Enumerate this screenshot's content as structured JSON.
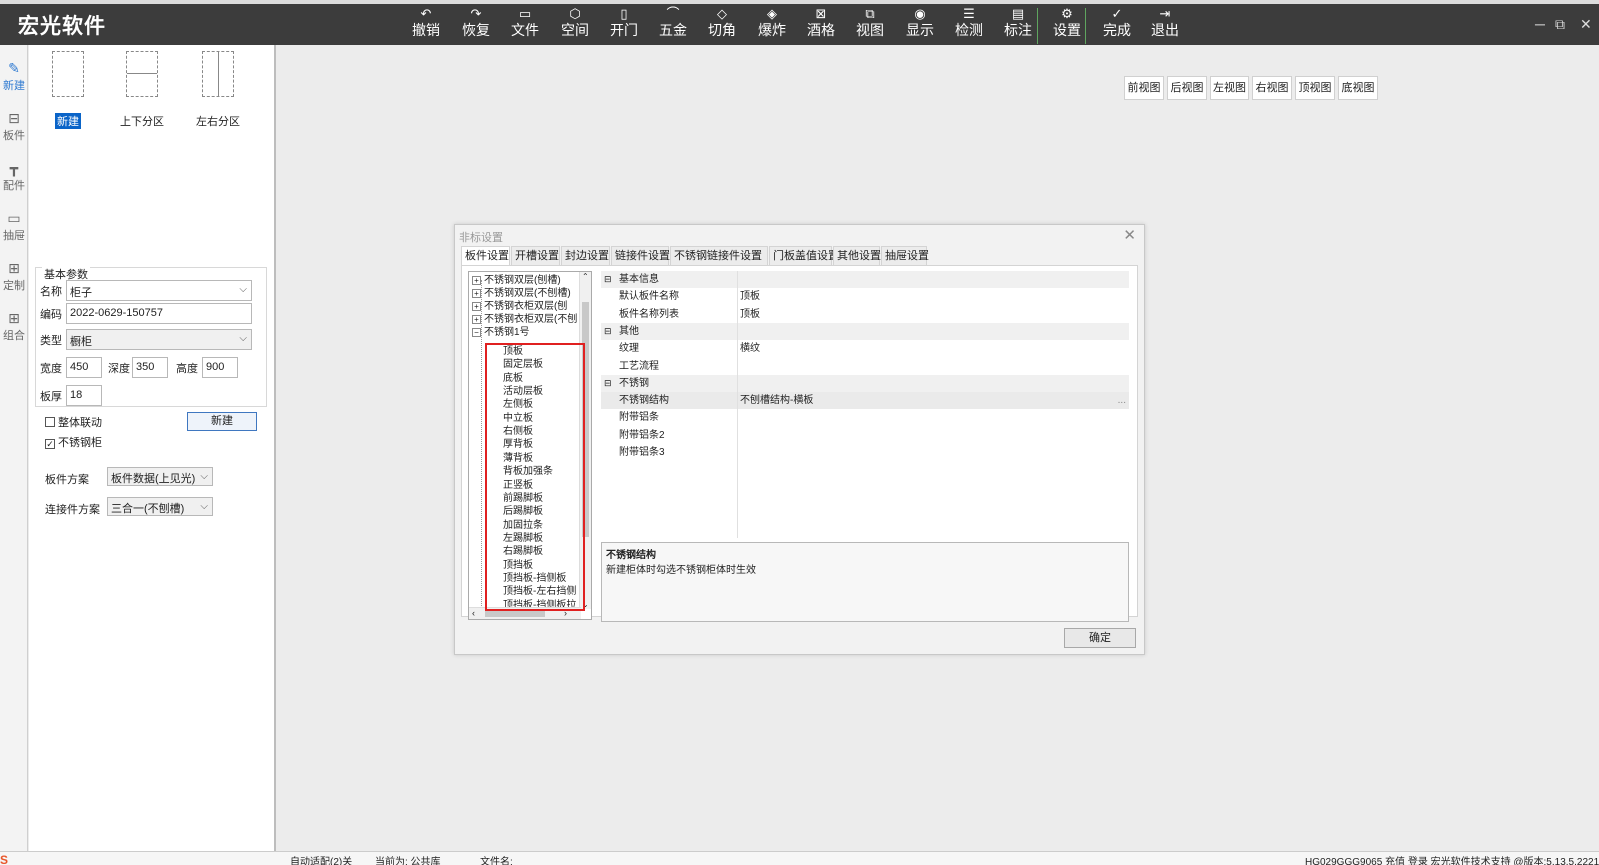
{
  "app": {
    "brand": "宏光软件"
  },
  "toolbar": [
    {
      "icon": "undo-icon",
      "glyph": "↶",
      "label": "撤销"
    },
    {
      "icon": "redo-icon",
      "glyph": "↷",
      "label": "恢复"
    },
    {
      "icon": "file-icon",
      "glyph": "▭",
      "label": "文件"
    },
    {
      "icon": "space-cube-icon",
      "glyph": "⬡",
      "label": "空间"
    },
    {
      "icon": "door-icon",
      "glyph": "▯",
      "label": "开门"
    },
    {
      "icon": "hardware-icon",
      "glyph": "⌒",
      "label": "五金"
    },
    {
      "icon": "corner-cut-icon",
      "glyph": "◇",
      "label": "切角"
    },
    {
      "icon": "explode-cube-icon",
      "glyph": "◈",
      "label": "爆炸"
    },
    {
      "icon": "wine-rack-icon",
      "glyph": "⊠",
      "label": "酒格"
    },
    {
      "icon": "view-icon",
      "glyph": "⧉",
      "label": "视图"
    },
    {
      "icon": "eye-icon",
      "glyph": "◉",
      "label": "显示"
    },
    {
      "icon": "check-list-icon",
      "glyph": "☰",
      "label": "检测"
    },
    {
      "icon": "annotation-icon",
      "glyph": "▤",
      "label": "标注"
    },
    {
      "icon": "settings-icon",
      "glyph": "⚙",
      "label": "设置"
    },
    {
      "icon": "done-check-icon",
      "glyph": "✓",
      "label": "完成"
    },
    {
      "icon": "exit-icon",
      "glyph": "⇥",
      "label": "退出"
    }
  ],
  "window_controls": {
    "minimize": "─",
    "restore": "⧉",
    "close": "✕"
  },
  "rail": [
    {
      "icon": "edit-icon",
      "glyph": "✎",
      "label": "新建"
    },
    {
      "icon": "sofa-board-icon",
      "glyph": "⊟",
      "label": "板件"
    },
    {
      "icon": "fitting-icon",
      "glyph": "┳",
      "label": "配件"
    },
    {
      "icon": "drawer-icon",
      "glyph": "▭",
      "label": "抽屉"
    },
    {
      "icon": "custom-icon",
      "glyph": "⊞",
      "label": "定制"
    },
    {
      "icon": "combine-icon",
      "glyph": "⊞",
      "label": "组合"
    }
  ],
  "templates": [
    {
      "label": "新建",
      "selected": true
    },
    {
      "label": "上下分区",
      "selected": false
    },
    {
      "label": "左右分区",
      "selected": false
    }
  ],
  "params": {
    "header": "基本参数",
    "name_label": "名称",
    "name_value": "柜子",
    "code_label": "编码",
    "code_value": "2022-0629-150757",
    "type_label": "类型",
    "type_value": "橱柜",
    "width_label": "宽度",
    "width_value": "450",
    "depth_label": "深度",
    "depth_value": "350",
    "height_label": "高度",
    "height_value": "900",
    "thickness_label": "板厚",
    "thickness_value": "18",
    "linkage_label": "整体联动",
    "linkage_checked": false,
    "stainless_label": "不锈钢柜",
    "stainless_checked": true,
    "create_button": "新建",
    "board_scheme_label": "板件方案",
    "board_scheme_value": "板件数据(上见光)",
    "connector_scheme_label": "连接件方案",
    "connector_scheme_value": "三合一(不刨槽)"
  },
  "views": [
    "前视图",
    "后视图",
    "左视图",
    "右视图",
    "顶视图",
    "底视图"
  ],
  "dialog": {
    "title": "非标设置",
    "close": "✕",
    "tabs": [
      "板件设置",
      "开槽设置",
      "封边设置",
      "链接件设置",
      "不锈钢链接件设置",
      "门板盖值设置",
      "其他设置",
      "抽屉设置"
    ],
    "active_tab": 0,
    "tree": {
      "groups": [
        "不锈钢双层(刨槽)",
        "不锈钢双层(不刨槽)",
        "不锈钢衣柜双层(刨",
        "不锈钢衣柜双层(不刨",
        "不锈钢1号"
      ],
      "items": [
        "顶板",
        "固定层板",
        "底板",
        "活动层板",
        "左侧板",
        "中立板",
        "右侧板",
        "厚背板",
        "薄背板",
        "背板加强条",
        "正竖板",
        "前踢脚板",
        "后踢脚板",
        "加固拉条",
        "左踢脚板",
        "右踢脚板",
        "顶挡板",
        "顶挡板-挡侧板",
        "顶挡板-左右挡侧",
        "顶挡板-挡侧板拉"
      ]
    },
    "properties": [
      {
        "type": "category",
        "key": "基本信息"
      },
      {
        "type": "row",
        "key": "默认板件名称",
        "value": "顶板"
      },
      {
        "type": "row",
        "key": "板件名称列表",
        "value": "顶板"
      },
      {
        "type": "category",
        "key": "其他"
      },
      {
        "type": "row",
        "key": "纹理",
        "value": "横纹"
      },
      {
        "type": "row",
        "key": "工艺流程",
        "value": ""
      },
      {
        "type": "category",
        "key": "不锈钢"
      },
      {
        "type": "row",
        "key": "不锈钢结构",
        "value": "不刨槽结构-横板",
        "selected": true,
        "ellipsis": "..."
      },
      {
        "type": "row",
        "key": "附带铝条",
        "value": ""
      },
      {
        "type": "row",
        "key": "附带铝条2",
        "value": ""
      },
      {
        "type": "row",
        "key": "附带铝条3",
        "value": ""
      }
    ],
    "description": {
      "title": "不锈钢结构",
      "text": "新建柜体时勾选不锈钢柜体时生效"
    },
    "ok": "确定"
  },
  "status": {
    "auto_match": "自动适配(2)关",
    "current": "当前为: 公共库",
    "filename": "文件名:",
    "right": "HG029GGG9065  充值  登录   宏光软件技术支持 @版本:5.13.5.2221"
  },
  "colors": {
    "topbar": "#3c3c3c",
    "accent": "#0a64c8",
    "highlight": "#e02020"
  }
}
